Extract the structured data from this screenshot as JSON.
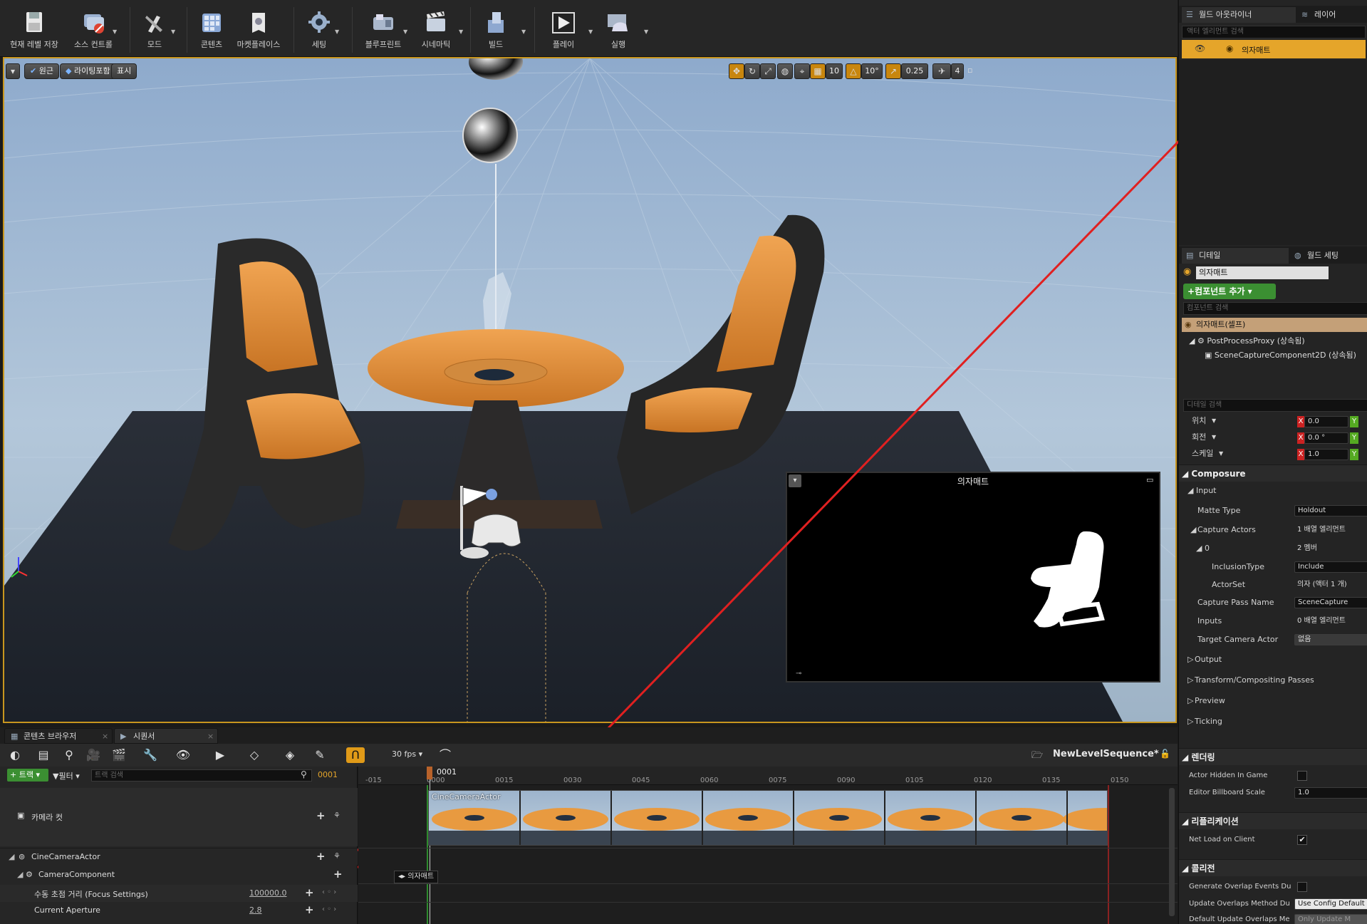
{
  "toolbar": {
    "items": [
      {
        "label": "현재 레벨 저장",
        "icon": "save-icon"
      },
      {
        "label": "소스 컨트롤",
        "icon": "source-control-icon"
      },
      {
        "label": "모드",
        "icon": "modes-icon"
      },
      {
        "label": "콘텐츠",
        "icon": "content-icon"
      },
      {
        "label": "마켓플레이스",
        "icon": "marketplace-icon"
      },
      {
        "label": "세팅",
        "icon": "settings-gear-icon"
      },
      {
        "label": "블루프린트",
        "icon": "blueprint-icon"
      },
      {
        "label": "시네마틱",
        "icon": "cinematics-icon"
      },
      {
        "label": "빌드",
        "icon": "build-icon"
      },
      {
        "label": "플레이",
        "icon": "play-icon"
      },
      {
        "label": "실행",
        "icon": "launch-icon"
      }
    ]
  },
  "viewport": {
    "perspective": "원근",
    "lighting": "라이팅포함",
    "show": "표시",
    "grid_snap": "10",
    "rotation_snap": "10°",
    "scale_snap": "0.25",
    "camera_speed": "4",
    "preview_title": "의자매트"
  },
  "outliner": {
    "tab_outliner": "월드 아웃라이너",
    "tab_layers": "레이어",
    "search_placeholder": "액터 엘리먼트 검색",
    "selected_item": "의자매트"
  },
  "details": {
    "tab_details": "디테일",
    "tab_world_settings": "월드 세팅",
    "actor_name": "의자매트",
    "add_component": "+컴포넌트 추가",
    "component_search_placeholder": "컴포넌트 검색",
    "components": [
      "의자매트(셀프)",
      "PostProcessProxy (상속됨)",
      "SceneCaptureComponent2D (상속됨)"
    ],
    "details_search_placeholder": "디테일 검색",
    "transform": {
      "location_label": "위치",
      "rotation_label": "회전",
      "scale_label": "스케일",
      "location_x": "0.0",
      "rotation_x": "0.0 °",
      "scale_x": "1.0"
    },
    "composure": {
      "title": "Composure",
      "input": "Input",
      "matte_type_label": "Matte Type",
      "matte_type_value": "Holdout",
      "capture_actors_label": "Capture Actors",
      "capture_actors_value": "1 배열 엘리먼트",
      "index0_label": "0",
      "index0_value": "2 멤버",
      "inclusion_type_label": "InclusionType",
      "inclusion_type_value": "Include",
      "actor_set_label": "ActorSet",
      "actor_set_value": "의자 (액터 1 개)",
      "capture_pass_label": "Capture Pass Name",
      "capture_pass_value": "SceneCapture",
      "inputs_label": "Inputs",
      "inputs_value": "0 배열 엘리먼트",
      "target_camera_label": "Target Camera Actor",
      "target_camera_value": "없음",
      "output": "Output",
      "transform_passes": "Transform/Compositing Passes",
      "preview": "Preview",
      "ticking": "Ticking"
    },
    "rendering": {
      "title": "렌더링",
      "actor_hidden_label": "Actor Hidden In Game",
      "billboard_label": "Editor Billboard Scale",
      "billboard_value": "1.0"
    },
    "replication": {
      "title": "리플리케이션",
      "net_load_label": "Net Load on Client"
    },
    "collision": {
      "title": "콜리전",
      "overlap_events_label": "Generate Overlap Events Du",
      "update_overlaps_label": "Update Overlaps Method Du",
      "update_overlaps_value": "Use Config Default",
      "default_update_label": "Default Update Overlaps Me",
      "default_update_value": "Only Update M"
    }
  },
  "bottom_tabs": {
    "content_browser": "콘텐츠 브라우저",
    "sequencer": "시퀀서"
  },
  "sequencer": {
    "fps": "30 fps",
    "sequence_name": "NewLevelSequence*",
    "track_button": "트랙",
    "filter_button": "필터",
    "track_search_placeholder": "트랙 검색",
    "current_frame": "0001",
    "playhead_label": "0001",
    "ticks": [
      "-015",
      "0000",
      "0015",
      "0030",
      "0045",
      "0060",
      "0075",
      "0090",
      "0105",
      "0120",
      "0135",
      "0150"
    ],
    "tracks": {
      "camera_cut": "카메라 컷",
      "cine_camera_actor": "CineCameraActor",
      "camera_component": "CameraComponent",
      "focus_label": "수동 초점 거리 (Focus Settings)",
      "focus_value": "100000.0",
      "aperture_label": "Current Aperture",
      "aperture_value": "2.8"
    },
    "clip_label": "CineCameraActor",
    "dropped_item": "의자매트"
  },
  "colors": {
    "accent": "#c8961e",
    "highlight_row": "#e5a52a",
    "annotation": "#e02020",
    "green": "#3fa23a"
  }
}
